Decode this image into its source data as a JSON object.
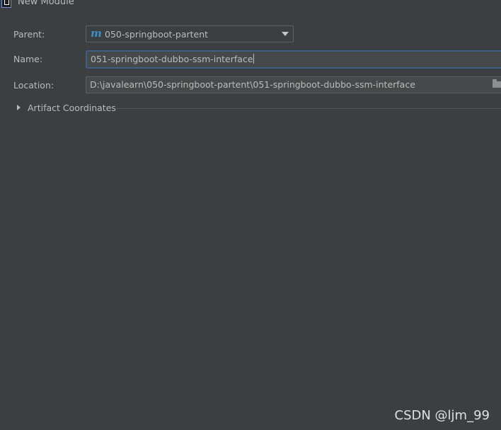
{
  "window": {
    "title": "New Module",
    "icon": "intellij-icon"
  },
  "form": {
    "parent_label": "Parent:",
    "parent_value": "050-springboot-partent",
    "parent_icon": "maven-m-icon",
    "name_label": "Name:",
    "name_value": "051-springboot-dubbo-ssm-interface",
    "location_label": "Location:",
    "location_value": "D:\\javalearn\\050-springboot-partent\\051-springboot-dubbo-ssm-interface",
    "location_icon": "folder-icon"
  },
  "sections": {
    "artifact_coordinates_label": "Artifact Coordinates",
    "expanded": false
  },
  "watermark": "CSDN @ljm_99",
  "colors": {
    "background": "#3c3f41",
    "text": "#bbbbbb",
    "focus_border": "#3d6185",
    "maven_icon": "#3d8fc5"
  }
}
